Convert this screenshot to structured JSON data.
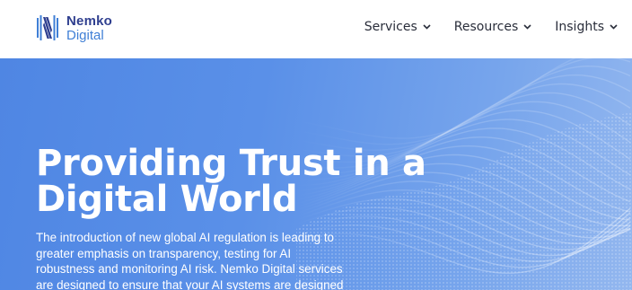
{
  "header": {
    "logo": {
      "name": "Nemko",
      "sub": "Digital",
      "icon": "nemko-logo-icon"
    },
    "nav": [
      {
        "label": "Services",
        "icon": "chevron-down-icon"
      },
      {
        "label": "Resources",
        "icon": "chevron-down-icon"
      },
      {
        "label": "Insights",
        "icon": "chevron-down-icon"
      }
    ]
  },
  "hero": {
    "title_line1": "Providing Trust in a",
    "title_line2": "Digital World",
    "description_lines": [
      "The introduction of new global AI regulation is leading to",
      "greater emphasis on transparency, testing for AI",
      "robustness and monitoring AI risk. Nemko Digital services",
      "are designed to ensure that your AI systems are designed"
    ]
  },
  "colors": {
    "brand_dark": "#2f3f8f",
    "brand_light": "#3f7fd6",
    "hero_blue": "#5a90e8",
    "nav_text": "#2a2e3b"
  }
}
